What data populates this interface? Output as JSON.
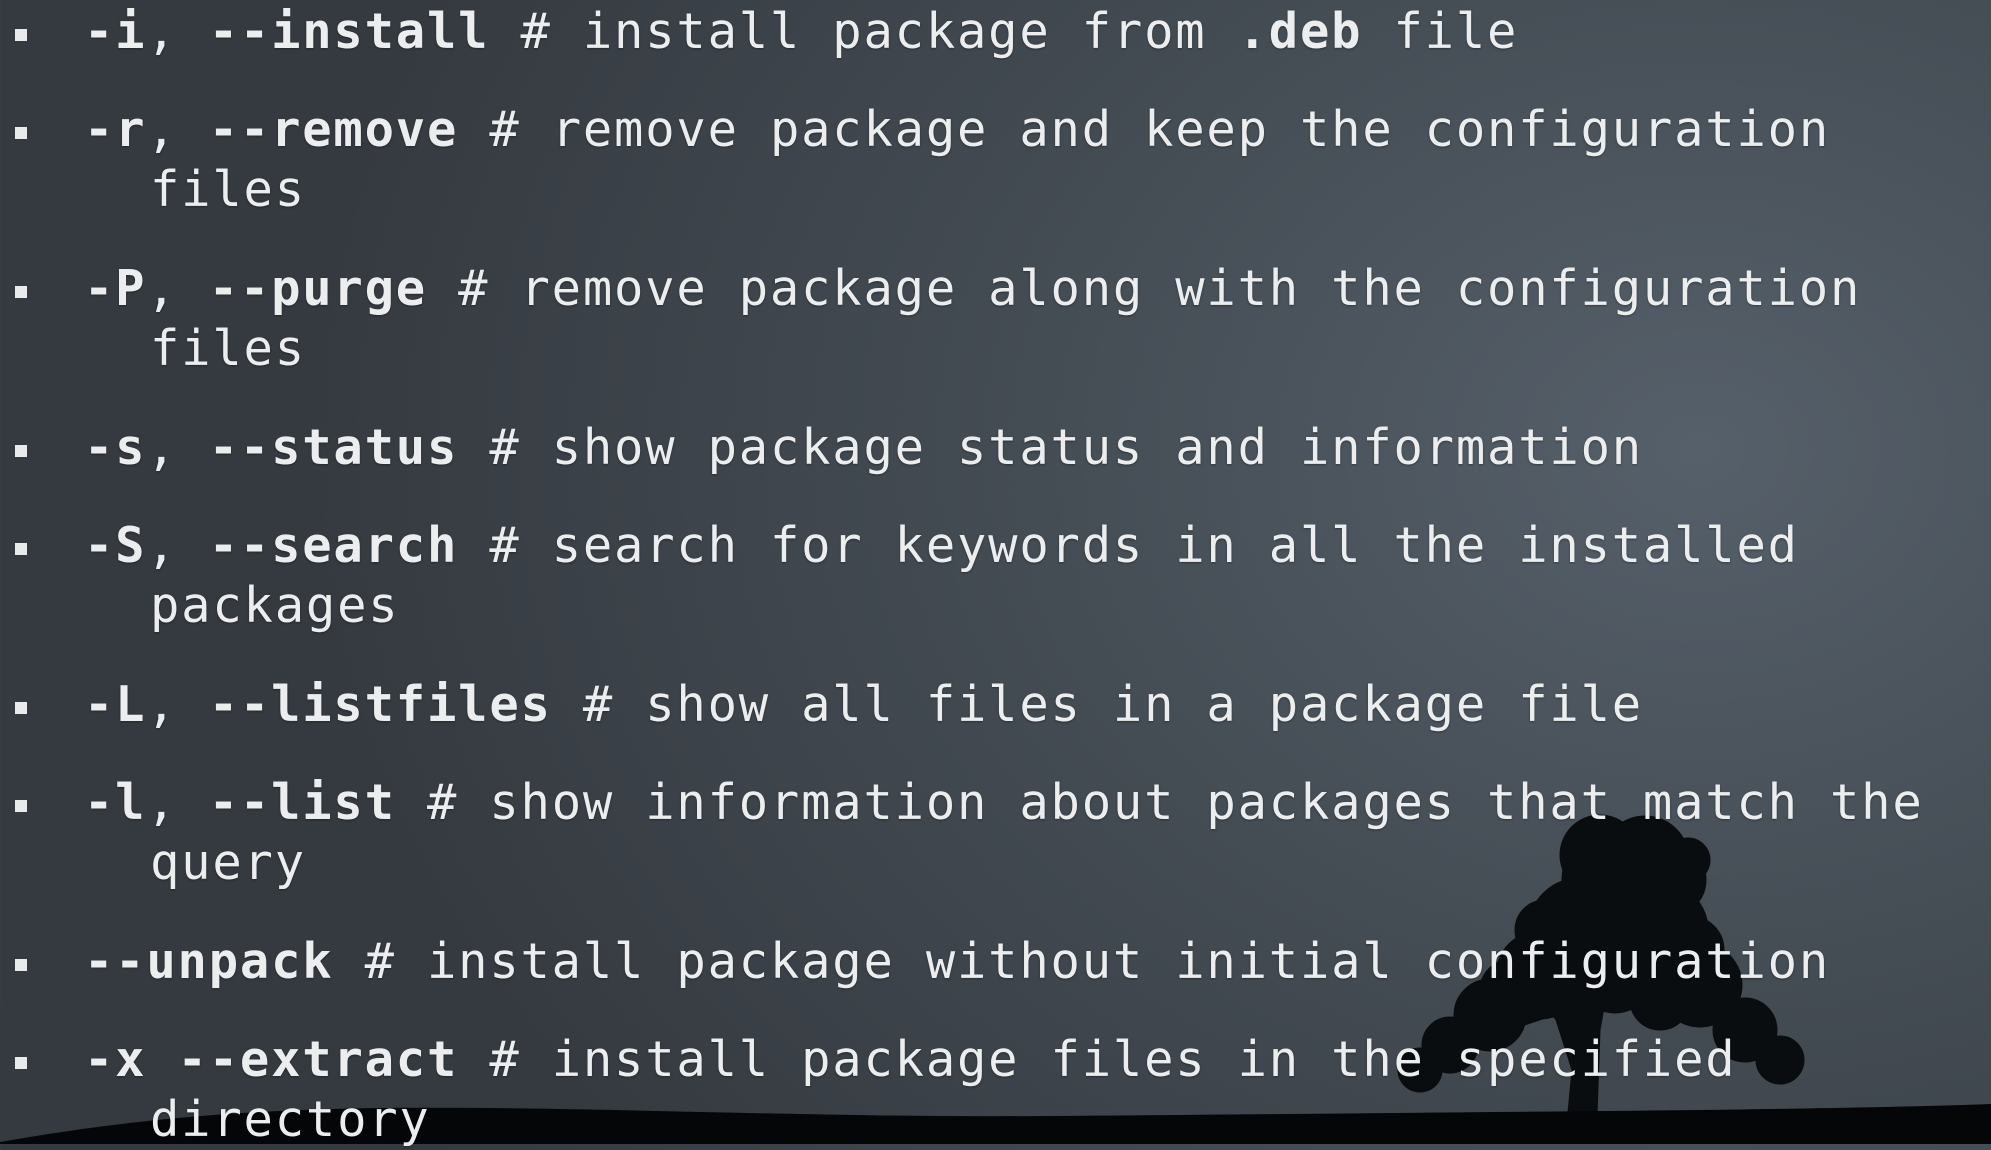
{
  "options": [
    {
      "short": "-i",
      "sep": ", ",
      "long": "--install",
      "desc": " # install package from ",
      "ext": ".deb",
      "desc_tail": " file",
      "cont": ""
    },
    {
      "short": "-r",
      "sep": ", ",
      "long": "--remove",
      "desc": " # remove package and keep the configuration",
      "ext": "",
      "desc_tail": "",
      "cont": "files"
    },
    {
      "short": "-P",
      "sep": ", ",
      "long": "--purge",
      "desc": " # remove package along with the configuration",
      "ext": "",
      "desc_tail": "",
      "cont": "files"
    },
    {
      "short": "-s",
      "sep": ", ",
      "long": "--status",
      "desc": " # show package status and information",
      "ext": "",
      "desc_tail": "",
      "cont": ""
    },
    {
      "short": "-S",
      "sep": ", ",
      "long": "--search",
      "desc": " # search for keywords in all the installed",
      "ext": "",
      "desc_tail": "",
      "cont": "packages"
    },
    {
      "short": "-L",
      "sep": ", ",
      "long": "--listfiles",
      "desc": " # show all files in a package file",
      "ext": "",
      "desc_tail": "",
      "cont": ""
    },
    {
      "short": "-l",
      "sep": ", ",
      "long": "--list",
      "desc": " # show information about packages that match the",
      "ext": "",
      "desc_tail": "",
      "cont": "query"
    },
    {
      "short": "",
      "sep": "",
      "long": "--unpack",
      "desc": " # install package without initial configuration",
      "ext": "",
      "desc_tail": "",
      "cont": ""
    },
    {
      "short": "-x",
      "sep": " ",
      "long": "--extract",
      "desc": " # install package files in the specified",
      "ext": "",
      "desc_tail": "",
      "cont": "directory"
    }
  ],
  "theme": {
    "background": "#454d55",
    "text": "#ecedee",
    "silhouette": "#07090b"
  }
}
